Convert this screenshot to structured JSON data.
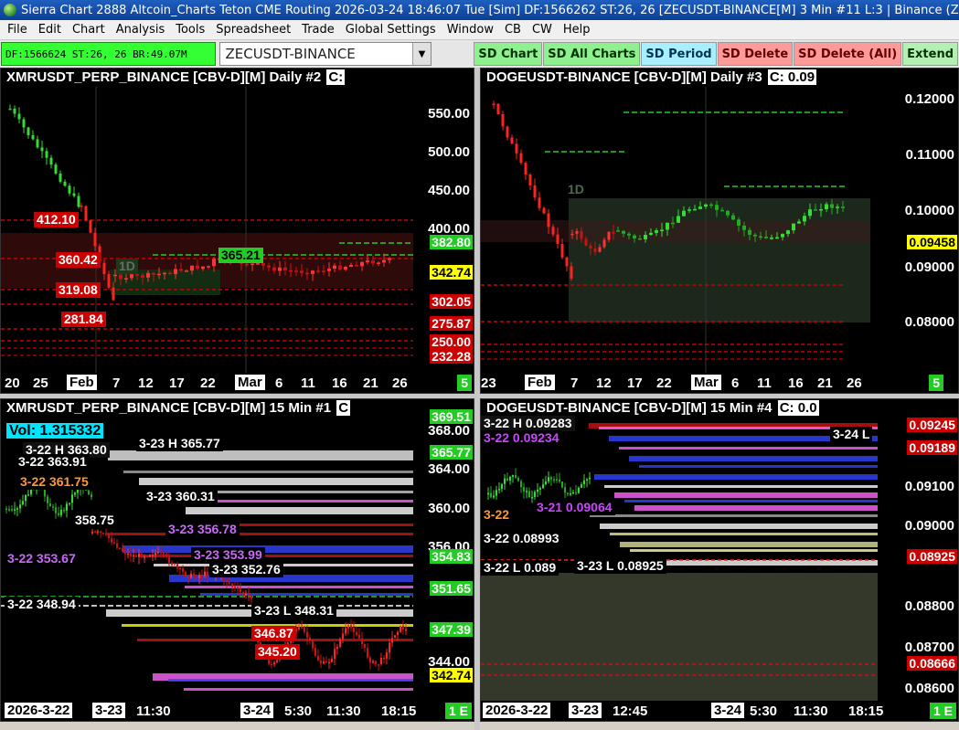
{
  "window": {
    "title": "Sierra Chart 2888 Altcoin_Charts Teton CME Routing 2026-03-24  18:46:07 Tue [Sim] DF:1566262  ST:26, 26 [ZECUSDT-BINANCE[M]  3 Min  #11 L:3 | Binance (ZE"
  },
  "menu": [
    "File",
    "Edit",
    "Chart",
    "Analysis",
    "Tools",
    "Spreadsheet",
    "Trade",
    "Global Settings",
    "Window",
    "CB",
    "CW",
    "Help"
  ],
  "toolbar": {
    "status": "DF:1566624  ST:26, 26  BR:49.07M",
    "symbol_value": "ZECUSDT-BINANCE",
    "buttons": [
      "SD Chart",
      "SD All Charts",
      "SD Period",
      "SD Delete",
      "SD Delete (All)",
      "Extend"
    ]
  },
  "charts": [
    {
      "header": "XMRUSDT_PERP_BINANCE [CBV-D][M]  Daily #2",
      "close_marker": "C:",
      "price_ticks": [
        "550.00",
        "500.00",
        "450.00",
        "400.00"
      ],
      "price_labels": [
        {
          "text": "382.80",
          "bg": "#22cc22",
          "fg": "#ffffff"
        },
        {
          "text": "342.74",
          "bg": "#ffff00",
          "fg": "#000000"
        },
        {
          "text": "302.05",
          "bg": "#cc0000",
          "fg": "#ffffff"
        },
        {
          "text": "275.87",
          "bg": "#cc0000",
          "fg": "#ffffff"
        },
        {
          "text": "250.00",
          "bg": "#cc0000",
          "fg": "#ffffff"
        },
        {
          "text": "232.28",
          "bg": "#cc0000",
          "fg": "#ffffff"
        }
      ],
      "level_labels": [
        {
          "text": "412.10",
          "bg": "#cc0000",
          "fg": "#ffffff"
        },
        {
          "text": "360.42",
          "bg": "#cc0000",
          "fg": "#ffffff"
        },
        {
          "text": "319.08",
          "bg": "#cc0000",
          "fg": "#ffffff"
        },
        {
          "text": "281.84",
          "bg": "#cc0000",
          "fg": "#ffffff"
        },
        {
          "text": "365.21",
          "bg": "#22cc22",
          "fg": "#000000"
        },
        {
          "text": "1D",
          "bg": "#1a3a1a",
          "fg": "#6a6a6a"
        }
      ],
      "time_labels": [
        "20",
        "25",
        "Feb",
        "7",
        "12",
        "17",
        "22",
        "Mar",
        "6",
        "11",
        "16",
        "21",
        "26"
      ],
      "tf_badge": "5"
    },
    {
      "header": "DOGEUSDT-BINANCE [CBV-D][M]  Daily #3",
      "close_marker": "C: 0.09",
      "price_ticks": [
        "0.12000",
        "0.11000",
        "0.10000",
        "0.09000",
        "0.08000"
      ],
      "price_labels": [
        {
          "text": "0.09458",
          "bg": "#ffff00",
          "fg": "#000000"
        }
      ],
      "level_labels": [
        {
          "text": "1D",
          "bg": "transparent",
          "fg": "#4a6a4a"
        }
      ],
      "time_labels": [
        "23",
        "Feb",
        "7",
        "12",
        "17",
        "22",
        "Mar",
        "6",
        "11",
        "16",
        "21",
        "26"
      ],
      "tf_badge": "5"
    },
    {
      "header": "XMRUSDT_PERP_BINANCE [CBV-D][M]  15 Min  #1",
      "close_marker": "C",
      "vol": "Vol: 1.315332",
      "price_ticks": [
        "368.00",
        "364.00",
        "360.00",
        "356.00",
        "344.00"
      ],
      "price_labels": [
        {
          "text": "369.51",
          "bg": "#22cc22",
          "fg": "#ffffff"
        },
        {
          "text": "365.77",
          "bg": "#22cc22",
          "fg": "#ffffff"
        },
        {
          "text": "354.83",
          "bg": "#22cc22",
          "fg": "#ffffff"
        },
        {
          "text": "351.65",
          "bg": "#22cc22",
          "fg": "#ffffff"
        },
        {
          "text": "347.39",
          "bg": "#22cc22",
          "fg": "#ffffff"
        },
        {
          "text": "342.74",
          "bg": "#ffff00",
          "fg": "#000000"
        }
      ],
      "level_labels": [
        {
          "text": "3-22 H   363.80",
          "bg": "#111111",
          "fg": "#ffffff"
        },
        {
          "text": "3-23 H   365.77",
          "bg": "#000000",
          "fg": "#ffffff"
        },
        {
          "text": "3-22   363.91",
          "bg": "#000000",
          "fg": "#ffffff"
        },
        {
          "text": "3-22   361.75",
          "bg": "#000000",
          "fg": "#ff9933"
        },
        {
          "text": "3-23   360.31",
          "bg": "#000000",
          "fg": "#ffffff"
        },
        {
          "text": "358.75",
          "bg": "#000000",
          "fg": "#ffffff"
        },
        {
          "text": "3-23   356.78",
          "bg": "#000000",
          "fg": "#cc66ff"
        },
        {
          "text": "3-22   353.67",
          "bg": "#000000",
          "fg": "#cc66ff"
        },
        {
          "text": "3-23   353.99",
          "bg": "#000000",
          "fg": "#cc66ff"
        },
        {
          "text": "3-23   352.76",
          "bg": "#000000",
          "fg": "#ffffff"
        },
        {
          "text": "3-22   348.94",
          "bg": "#000000",
          "fg": "#ffffff"
        },
        {
          "text": "3-23 L  348.31",
          "bg": "#000000",
          "fg": "#ffffff"
        },
        {
          "text": "346.87",
          "bg": "#cc0000",
          "fg": "#ffffff"
        },
        {
          "text": "345.20",
          "bg": "#cc0000",
          "fg": "#ffffff"
        }
      ],
      "time_labels": [
        "2026-3-22",
        "3-23",
        "11:30",
        "3-24",
        "5:30",
        "11:30",
        "18:15"
      ],
      "tf_badge": "1 E"
    },
    {
      "header": "DOGEUSDT-BINANCE [CBV-D][M]  15 Min  #4",
      "close_marker": "C: 0.0",
      "price_ticks": [
        "0.09100",
        "0.09000",
        "0.08800",
        "0.08700",
        "0.08600"
      ],
      "price_labels": [
        {
          "text": "0.09245",
          "bg": "#cc0000",
          "fg": "#ffffff"
        },
        {
          "text": "0.09189",
          "bg": "#cc0000",
          "fg": "#ffffff"
        },
        {
          "text": "0.08925",
          "bg": "#cc0000",
          "fg": "#ffffff"
        },
        {
          "text": "0.08666",
          "bg": "#cc0000",
          "fg": "#ffffff"
        }
      ],
      "level_labels": [
        {
          "text": "3-22 H   0.09283",
          "bg": "#111111",
          "fg": "#ffffff"
        },
        {
          "text": "3-22   0.09234",
          "bg": "#000000",
          "fg": "#cc44ff"
        },
        {
          "text": "3-24 L",
          "bg": "#000000",
          "fg": "#ffffff"
        },
        {
          "text": "3-21   0.09064",
          "bg": "#000000",
          "fg": "#cc44ff"
        },
        {
          "text": "3-22",
          "bg": "#000000",
          "fg": "#ff9933"
        },
        {
          "text": "3-22   0.08993",
          "bg": "#000000",
          "fg": "#ffffff"
        },
        {
          "text": "3-22 L   0.089",
          "bg": "#000000",
          "fg": "#ffffff"
        },
        {
          "text": "3-23 L   0.08925",
          "bg": "#000000",
          "fg": "#ffffff"
        }
      ],
      "time_labels": [
        "2026-3-22",
        "3-23",
        "12:45",
        "3-24",
        "5:30",
        "11:30",
        "18:15"
      ],
      "tf_badge": "1 E"
    }
  ]
}
